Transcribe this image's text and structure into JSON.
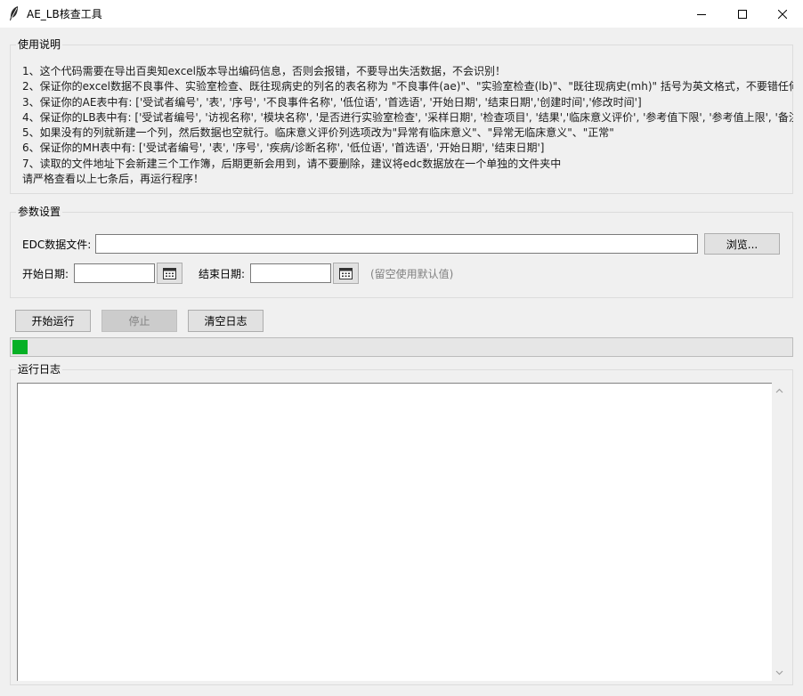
{
  "window": {
    "title": "AE_LB核查工具",
    "icon": "feather-icon"
  },
  "instructions": {
    "group_label": "使用说明",
    "lines": [
      "1、这个代码需要在导出百奥知excel版本导出编码信息，否则会报错，不要导出失活数据，不会识别！",
      "2、保证你的excel数据不良事件、实验室检查、既往现病史的列名的表名称为 \"不良事件(ae)\"、\"实验室检查(lb)\"、\"既往现病史(mh)\" 括号为英文格式，不要错任何",
      "3、保证你的AE表中有: ['受试者编号', '表', '序号', '不良事件名称', '低位语', '首选语', '开始日期', '结束日期','创建时间','修改时间']",
      "4、保证你的LB表中有: ['受试者编号', '访视名称', '模块名称', '是否进行实验室检查', '采样日期', '检查项目', '结果','临床意义评价', '参考值下限', '参考值上限', '备注",
      "5、如果没有的列就新建一个列，然后数据也空就行。临床意义评价列选项改为\"异常有临床意义\"、\"异常无临床意义\"、\"正常\"",
      "6、保证你的MH表中有: ['受试者编号', '表', '序号', '疾病/诊断名称', '低位语', '首选语', '开始日期', '结束日期']",
      "7、读取的文件地址下会新建三个工作簿，后期更新会用到，请不要删除，建议将edc数据放在一个单独的文件夹中",
      "请严格查看以上七条后，再运行程序！"
    ]
  },
  "params": {
    "group_label": "参数设置",
    "edc_label": "EDC数据文件:",
    "edc_value": "",
    "browse_label": "浏览...",
    "start_label": "开始日期:",
    "start_value": "",
    "end_label": "结束日期:",
    "end_value": "",
    "date_hint": "(留空使用默认值)"
  },
  "actions": {
    "run_label": "开始运行",
    "stop_label": "停止",
    "clear_label": "清空日志"
  },
  "progress": {
    "value_fraction": 0.02,
    "color": "#06b025"
  },
  "log": {
    "group_label": "运行日志",
    "content": ""
  }
}
